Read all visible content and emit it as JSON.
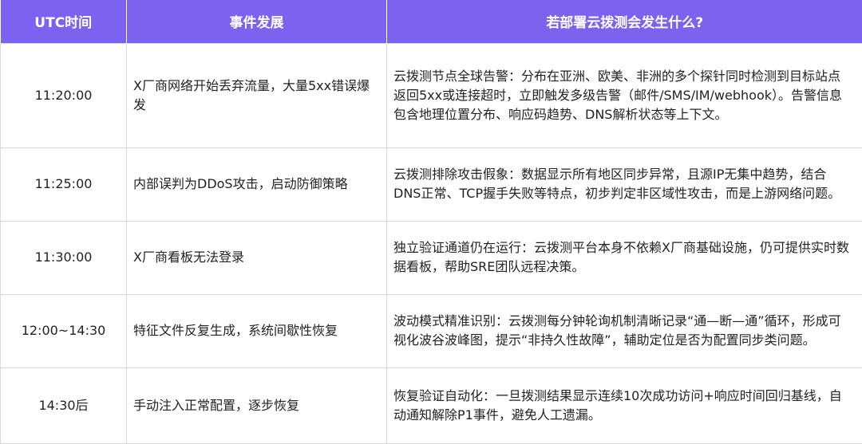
{
  "header": {
    "col1": "UTC时间",
    "col2": "事件发展",
    "col3": "若部署云拨测会发生什么?"
  },
  "rows": [
    {
      "time": "11:20:00",
      "event": "X厂商网络开始丢弃流量，大量5xx错误爆发",
      "cloud": "云拨测节点全球告警：分布在亚洲、欧美、非洲的多个探针同时检测到目标站点返回5xx或连接超时，立即触发多级告警（邮件/SMS/IM/webhook）。告警信息包含地理位置分布、响应码趋势、DNS解析状态等上下文。"
    },
    {
      "time": "11:25:00",
      "event": "内部误判为DDoS攻击，启动防御策略",
      "cloud": "云拨测排除攻击假象：数据显示所有地区同步异常，且源IP无集中趋势，结合DNS正常、TCP握手失败等特点，初步判定非区域性攻击，而是上游网络问题。"
    },
    {
      "time": "11:30:00",
      "event": "X厂商看板无法登录",
      "cloud": "独立验证通道仍在运行：云拨测平台本身不依赖X厂商基础设施，仍可提供实时数据看板，帮助SRE团队远程决策。"
    },
    {
      "time": "12:00~14:30",
      "event": "特征文件反复生成，系统间歇性恢复",
      "cloud": "波动模式精准识别：云拨测每分钟轮询机制清晰记录“通—断—通”循环，形成可视化波谷波峰图，提示“非持久性故障”，辅助定位是否为配置同步类问题。"
    },
    {
      "time": "14:30后",
      "event": "手动注入正常配置，逐步恢复",
      "cloud": "恢复验证自动化：一旦拨测结果显示连续10次成功访问+响应时间回归基线，自动通知解除P1事件，避免人工遗漏。"
    }
  ]
}
